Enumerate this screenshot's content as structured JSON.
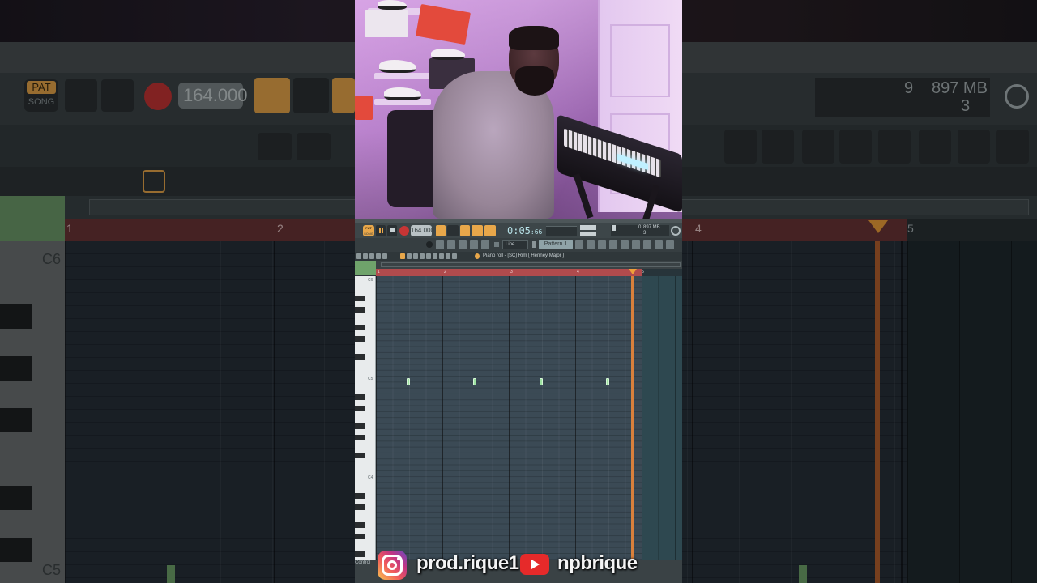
{
  "background": {
    "pat_label": "PAT",
    "song_label": "SONG",
    "tempo": "164.000",
    "memory": "897 MB",
    "cpu": "9",
    "voices": "3",
    "key_c6": "C6",
    "key_c5": "C5",
    "bar_numbers": [
      "1",
      "2",
      "4",
      "5"
    ]
  },
  "transport": {
    "pat_label": "PAT",
    "song_label": "SONG",
    "tempo": "164.000",
    "time": "0:05",
    "time_frac": "66",
    "cpu": "0",
    "memory": "897 MB",
    "voices": "3"
  },
  "toolbar": {
    "snap": "Line",
    "pattern": "Pattern 1"
  },
  "piano_roll": {
    "title": "Piano roll - [SC] Rim [ Henney Major ]",
    "bar_numbers": [
      "1",
      "2",
      "3",
      "4",
      "5"
    ],
    "key_labels": [
      "C6",
      "C5",
      "C4"
    ],
    "control_label": "Control",
    "notes": [
      {
        "bar": 1,
        "pitch": "C5"
      },
      {
        "bar": 2,
        "pitch": "C5"
      },
      {
        "bar": 3,
        "pitch": "C5"
      },
      {
        "bar": 4,
        "pitch": "C5"
      }
    ]
  },
  "social": {
    "instagram_handle": "prod.rique1",
    "youtube_handle": "npbrique",
    "instagram_icon": "instagram-icon",
    "youtube_icon": "youtube-icon"
  },
  "colors": {
    "accent_orange": "#e8a74a",
    "timeline_red": "#b14b4d",
    "note_green": "#9ee3a2",
    "playhead": "#d9803c"
  }
}
